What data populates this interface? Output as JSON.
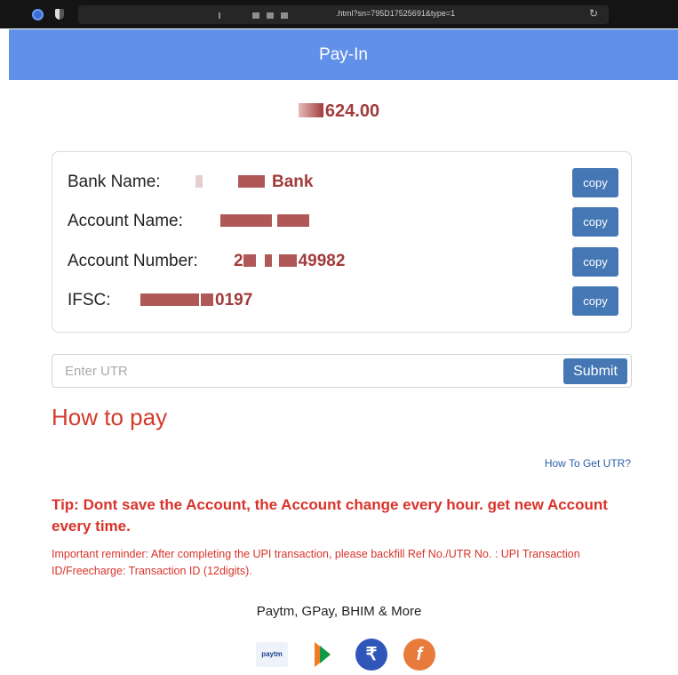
{
  "browser": {
    "url": ".html?sn=795D17525691&type=1",
    "reload_icon": "reload-icon"
  },
  "header": {
    "title": "Pay-In"
  },
  "amount": {
    "value": "624.00"
  },
  "details": {
    "bank_name_label": "Bank Name:",
    "bank_name_value": "Bank",
    "account_name_label": "Account Name:",
    "account_number_label": "Account Number:",
    "account_number_value": "49982",
    "account_number_prefix": "2",
    "ifsc_label": "IFSC:",
    "ifsc_value": "0197",
    "copy_label": "copy"
  },
  "utr": {
    "placeholder": "Enter UTR",
    "submit_label": "Submit"
  },
  "how_to_pay": {
    "title": "How to pay",
    "utr_link": "How To Get UTR?"
  },
  "tip": "Tip: Dont save the Account, the Account change every hour. get new Account every time.",
  "reminder": "Important reminder: After completing the UPI transaction, please backfill Ref No./UTR No. : UPI Transaction ID/Freecharge: Transaction ID (12digits).",
  "methods": {
    "text": "Paytm, GPay, BHIM & More",
    "paytm_logo_text": "paytm",
    "upi_symbol": "₹",
    "freecharge_symbol": "f"
  },
  "colors": {
    "header_bg": "#6090e8",
    "button_bg": "#4577b5",
    "value_text": "#a23b3b",
    "warning_red": "#d8332a"
  }
}
